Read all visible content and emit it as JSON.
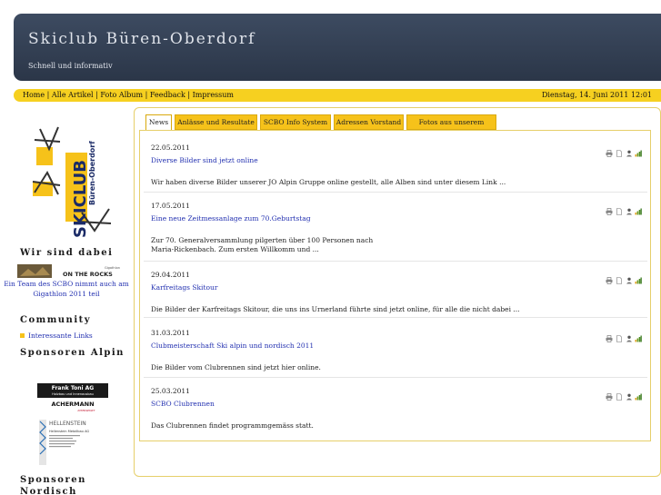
{
  "header": {
    "title": "Skiclub Büren-Oberdorf",
    "tagline": "Schnell und informativ"
  },
  "menu": {
    "items": [
      "Home",
      "Alle Artikel",
      "Foto Album",
      "Feedback",
      "Impressum"
    ],
    "separator": "|",
    "date": "Dienstag, 14. Juni 2011 12:01"
  },
  "sidebar": {
    "logo_text": "SKICLUB",
    "logo_subtext": "Büren-Oberdorf",
    "sections": {
      "wir_sind_dabei": "Wir sind dabei",
      "community": "Community",
      "sponsoren_alpin": "Sponsoren Alpin",
      "sponsoren_nordisch_1": "Sponsoren",
      "sponsoren_nordisch_2": "Nordisch"
    },
    "gigathlon_banner": {
      "small": "Gigathlon",
      "big": "ON THE ROCKS"
    },
    "gigathlon_text": "Ein Team des SCBO nimmt auch am Gigathlon 2011 teil",
    "community_link": "Interessante Links",
    "sponsors": {
      "frank_toni": "Frank Toni AG",
      "frank_toni_sub": "Holzbau und Innenausbau",
      "achermann": "ACHERMANN",
      "achermann_sub": "INTERSPORT",
      "hellenstein": "HELLENSTEIN",
      "hellenstein_sub": "Hellenstein Metallbau AG"
    }
  },
  "tabs": [
    {
      "label": "News",
      "active": true
    },
    {
      "label": "Anlässe und Resultate",
      "active": false
    },
    {
      "label": "SCBO Info System",
      "active": false
    },
    {
      "label": "Adressen Vorstand",
      "active": false
    },
    {
      "label": "Fotos aus unserem Album",
      "active": false
    }
  ],
  "articles": [
    {
      "date": "22.05.2011",
      "title": "Diverse Bilder sind jetzt online",
      "teaser": "Wir haben diverse Bilder unserer JO Alpin Gruppe online gestellt, alle Alben sind unter diesem Link ..."
    },
    {
      "date": "17.05.2011",
      "title": "Eine neue Zeitmessanlage zum 70.Geburtstag",
      "teaser_line1": "Zur 70. Generalversammlung pilgerten über 100 Personen nach",
      "teaser_line2": "Maria-Rickenbach. Zum ersten Willkomm und ..."
    },
    {
      "date": "29.04.2011",
      "title": "Karfreitags Skitour",
      "teaser": "Die Bilder der Karfreitags Skitour, die uns ins Urnerland führte sind jetzt online, für alle die nicht dabei ..."
    },
    {
      "date": "31.03.2011",
      "title": "Clubmeisterschaft Ski alpin und nordisch 2011",
      "teaser": "Die Bilder vom Clubrennen sind jetzt hier online."
    },
    {
      "date": "25.03.2011",
      "title": "SCBO Clubrennen",
      "teaser": "Das Clubrennen findet programmgemäss statt."
    }
  ],
  "article_icons": [
    "printer-icon",
    "pdf-icon",
    "user-icon",
    "rating-icon"
  ],
  "colors": {
    "header_bg": "#334055",
    "menubar": "#f6d020",
    "tab": "#f6c21a",
    "link": "#2230b0"
  }
}
